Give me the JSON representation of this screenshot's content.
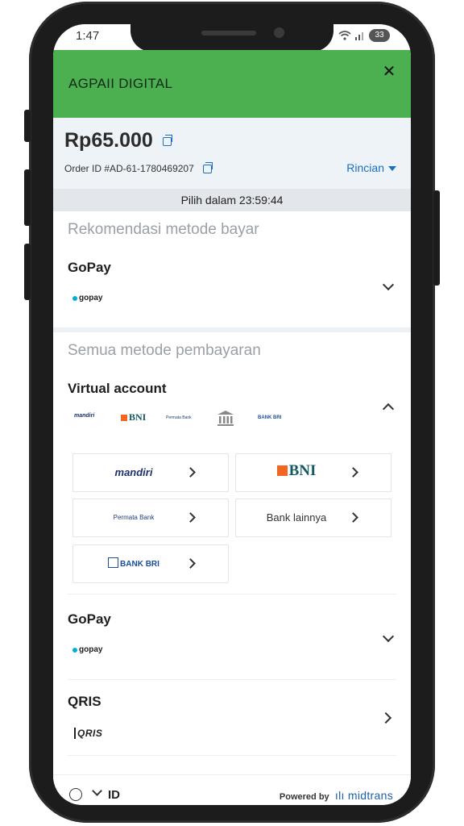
{
  "status_bar": {
    "time": "1:47",
    "battery": "33"
  },
  "header": {
    "merchant": "AGPAII DIGITAL",
    "close_symbol": "✕"
  },
  "summary": {
    "amount": "Rp65.000",
    "order_id": "Order ID #AD-61-1780469207",
    "details_label": "Rincian"
  },
  "timer": {
    "text": "Pilih dalam 23:59:44"
  },
  "recommended": {
    "title": "Rekomendasi metode bayar",
    "method": "GoPay",
    "logo_text": "gopay"
  },
  "all_methods": {
    "title": "Semua metode pembayaran",
    "virtual_account": {
      "label": "Virtual account",
      "logos": [
        "mandiri",
        "BNI",
        "Permata Bank",
        "bank-icon",
        "BANK BRI"
      ],
      "tiles": {
        "mandiri": "mandiri",
        "bni": "BNI",
        "permata": "Permata Bank",
        "other": "Bank lainnya",
        "bri": "BANK BRI"
      }
    },
    "gopay": {
      "label": "GoPay",
      "logo_text": "gopay"
    },
    "qris": {
      "label": "QRIS",
      "logo_text": "QRIS"
    }
  },
  "footer": {
    "language": "ID",
    "powered_by": "Powered by",
    "brand": "midtrans"
  },
  "colors": {
    "header": "#4caf50",
    "accent": "#1a6fc0",
    "muted": "#9aa0a6"
  }
}
